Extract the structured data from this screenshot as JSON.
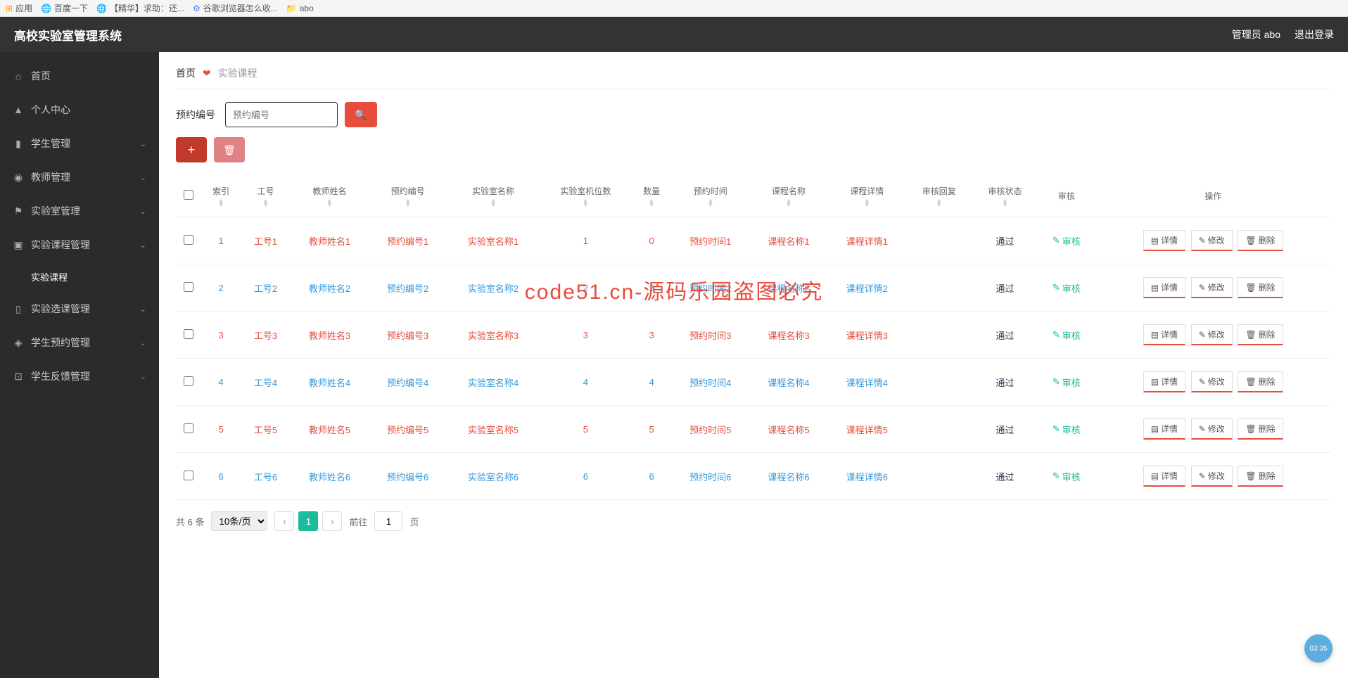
{
  "browser": {
    "apps": "应用",
    "baidu": "百度一下",
    "jinghua": "【精华】求助：还...",
    "google": "谷歌浏览器怎么收...",
    "abo": "abo"
  },
  "header": {
    "title": "高校实验室管理系统",
    "admin": "管理员 abo",
    "logout": "退出登录"
  },
  "sidebar": {
    "items": [
      {
        "icon": "⌂",
        "label": "首页",
        "expandable": false
      },
      {
        "icon": "▲",
        "label": "个人中心",
        "expandable": false
      },
      {
        "icon": "▮",
        "label": "学生管理",
        "expandable": true
      },
      {
        "icon": "◉",
        "label": "教师管理",
        "expandable": true
      },
      {
        "icon": "⚑",
        "label": "实验室管理",
        "expandable": true
      },
      {
        "icon": "▣",
        "label": "实验课程管理",
        "expandable": true,
        "sub": "实验课程"
      },
      {
        "icon": "▯",
        "label": "实验选课管理",
        "expandable": true
      },
      {
        "icon": "◈",
        "label": "学生预约管理",
        "expandable": true
      },
      {
        "icon": "⊡",
        "label": "学生反馈管理",
        "expandable": true
      }
    ]
  },
  "breadcrumb": {
    "home": "首页",
    "current": "实验课程"
  },
  "search": {
    "label": "预约编号",
    "placeholder": "预约编号"
  },
  "table": {
    "headers": [
      "索引",
      "工号",
      "教师姓名",
      "预约编号",
      "实验室名称",
      "实验室机位数",
      "数量",
      "预约时间",
      "课程名称",
      "课程详情",
      "审核回复",
      "审核状态",
      "审核",
      "操作"
    ],
    "rows": [
      {
        "idx": "1",
        "gh": "工号1",
        "teacher": "教师姓名1",
        "yy": "预约编号1",
        "lab": "实验室名称1",
        "seats": "1",
        "qty": "0",
        "time": "预约时间1",
        "course": "课程名称1",
        "detail": "课程详情1",
        "reply": "",
        "status": "通过",
        "odd": true
      },
      {
        "idx": "2",
        "gh": "工号2",
        "teacher": "教师姓名2",
        "yy": "预约编号2",
        "lab": "实验室名称2",
        "seats": "2",
        "qty": "2",
        "time": "预约时间2",
        "course": "课程名称2",
        "detail": "课程详情2",
        "reply": "",
        "status": "通过",
        "odd": false
      },
      {
        "idx": "3",
        "gh": "工号3",
        "teacher": "教师姓名3",
        "yy": "预约编号3",
        "lab": "实验室名称3",
        "seats": "3",
        "qty": "3",
        "time": "预约时间3",
        "course": "课程名称3",
        "detail": "课程详情3",
        "reply": "",
        "status": "通过",
        "odd": true
      },
      {
        "idx": "4",
        "gh": "工号4",
        "teacher": "教师姓名4",
        "yy": "预约编号4",
        "lab": "实验室名称4",
        "seats": "4",
        "qty": "4",
        "time": "预约时间4",
        "course": "课程名称4",
        "detail": "课程详情4",
        "reply": "",
        "status": "通过",
        "odd": false
      },
      {
        "idx": "5",
        "gh": "工号5",
        "teacher": "教师姓名5",
        "yy": "预约编号5",
        "lab": "实验室名称5",
        "seats": "5",
        "qty": "5",
        "time": "预约时间5",
        "course": "课程名称5",
        "detail": "课程详情5",
        "reply": "",
        "status": "通过",
        "odd": true
      },
      {
        "idx": "6",
        "gh": "工号6",
        "teacher": "教师姓名6",
        "yy": "预约编号6",
        "lab": "实验室名称6",
        "seats": "6",
        "qty": "6",
        "time": "预约时间6",
        "course": "课程名称6",
        "detail": "课程详情6",
        "reply": "",
        "status": "通过",
        "odd": false
      }
    ],
    "audit_label": "审核",
    "ops": {
      "detail": "详情",
      "edit": "修改",
      "delete": "删除"
    }
  },
  "pagination": {
    "total": "共 6 条",
    "page_size": "10条/页",
    "current": "1",
    "goto_label": "前往",
    "goto_value": "1",
    "page_suffix": "页"
  },
  "time_badge": "03:35",
  "watermark": "code51.cn-源码乐园盗图必究"
}
